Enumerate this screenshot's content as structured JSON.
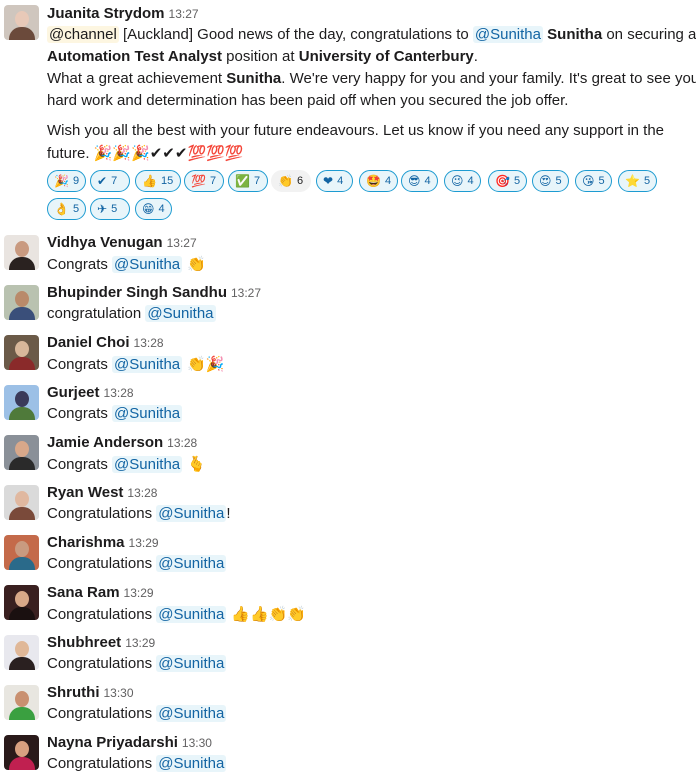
{
  "messages": [
    {
      "name": "Juanita Strydom",
      "time": "13:27",
      "avatar_colors": [
        "#cfc6be",
        "#6b4a3b",
        "#e8c9b8"
      ],
      "line1": {
        "channel": "@channel",
        "t1": " [Auckland] Good news of the day, congratulations to ",
        "mention": "@Sunitha",
        "t2": " ",
        "b1": "Sunitha",
        "t3": " on securing an"
      },
      "line2": {
        "b1": "Automation Test Analyst",
        "t1": " position at ",
        "b2": "University of Canterbury",
        "t2": "."
      },
      "line3": {
        "t1": "What a great achievement ",
        "b1": "Sunitha",
        "t2": ". We're very happy for you and your family. It's great to see your"
      },
      "line4": {
        "t1": "hard work and determination has been paid off when you secured the job offer."
      },
      "line5": {
        "t1": "Wish you all the best with your future endeavours. Let us know if you need any support in the"
      },
      "line6": {
        "t1": "future. ",
        "emoji": "🎉🎉🎉✔✔✔💯💯💯"
      },
      "reactions": [
        {
          "emoji": "🎉",
          "count": "9"
        },
        {
          "emoji": "✔",
          "count": "7"
        },
        {
          "emoji": "👍",
          "count": "15"
        },
        {
          "emoji": "💯",
          "count": "7"
        },
        {
          "emoji": "✅",
          "count": "7"
        },
        {
          "emoji": "👏",
          "count": "6"
        },
        {
          "emoji": "❤",
          "count": "4"
        },
        {
          "emoji": "🤩",
          "count": "4"
        },
        {
          "emoji": "😎",
          "count": "4"
        },
        {
          "emoji": "😉",
          "count": "4"
        },
        {
          "emoji": "🎯",
          "count": "5"
        },
        {
          "emoji": "😍",
          "count": "5"
        },
        {
          "emoji": "😘",
          "count": "5"
        },
        {
          "emoji": "⭐",
          "count": "5"
        },
        {
          "emoji": "👌",
          "count": "5"
        },
        {
          "emoji": "✈",
          "count": "5"
        },
        {
          "emoji": "😁",
          "count": "4"
        }
      ]
    },
    {
      "name": "Vidhya Venugan",
      "time": "13:27",
      "text": "Congrats ",
      "mention": "@Sunitha",
      "after": "",
      "emoji": "👏",
      "avatar_colors": [
        "#e9e4e0",
        "#2a2220",
        "#c99a80"
      ]
    },
    {
      "name": "Bhupinder Singh Sandhu",
      "time": "13:27",
      "text": "congratulation ",
      "mention": "@Sunitha",
      "after": "",
      "emoji": "",
      "avatar_colors": [
        "#b9c2b0",
        "#3a4f7a",
        "#b98a6a"
      ]
    },
    {
      "name": "Daniel Choi",
      "time": "13:28",
      "text": "Congrats ",
      "mention": "@Sunitha",
      "after": "",
      "emoji": "👏🎉",
      "avatar_colors": [
        "#6b5a48",
        "#8a2a2a",
        "#d8b79a"
      ]
    },
    {
      "name": "Gurjeet",
      "time": "13:28",
      "text": "Congrats ",
      "mention": "@Sunitha",
      "after": "",
      "emoji": "",
      "avatar_colors": [
        "#9cc0e6",
        "#4f7a3a",
        "#3a3a5a"
      ]
    },
    {
      "name": "Jamie Anderson",
      "time": "13:28",
      "text": "Congrats ",
      "mention": "@Sunitha",
      "after": "",
      "emoji": "🫰",
      "avatar_colors": [
        "#8a9098",
        "#2a2a2a",
        "#d8a88a"
      ]
    },
    {
      "name": "Ryan West",
      "time": "13:28",
      "text": "Congratulations ",
      "mention": "@Sunitha",
      "after": "!",
      "emoji": "",
      "avatar_colors": [
        "#dadada",
        "#7a4a3a",
        "#e0b8a0"
      ]
    },
    {
      "name": "Charishma",
      "time": "13:29",
      "text": "Congratulations ",
      "mention": "@Sunitha",
      "after": "",
      "emoji": "",
      "avatar_colors": [
        "#c46a4a",
        "#2a6a8a",
        "#c99a80"
      ]
    },
    {
      "name": "Sana Ram",
      "time": "13:29",
      "text": "Congratulations ",
      "mention": "@Sunitha",
      "after": "",
      "emoji": "👍👍👏👏",
      "avatar_colors": [
        "#3a2020",
        "#1a1010",
        "#d8a888"
      ]
    },
    {
      "name": "Shubhreet",
      "time": "13:29",
      "text": "Congratulations ",
      "mention": "@Sunitha",
      "after": "",
      "emoji": "",
      "avatar_colors": [
        "#e8e8ee",
        "#2a2020",
        "#e0b898"
      ]
    },
    {
      "name": "Shruthi",
      "time": "13:30",
      "text": "Congratulations ",
      "mention": "@Sunitha",
      "after": "",
      "emoji": "",
      "avatar_colors": [
        "#e8e6e0",
        "#3aa040",
        "#c99070"
      ]
    },
    {
      "name": "Nayna Priyadarshi",
      "time": "13:30",
      "text": "Congratulations ",
      "mention": "@Sunitha",
      "after": "",
      "emoji": "",
      "avatar_colors": [
        "#2a1a1a",
        "#c02050",
        "#d8a080"
      ]
    }
  ]
}
